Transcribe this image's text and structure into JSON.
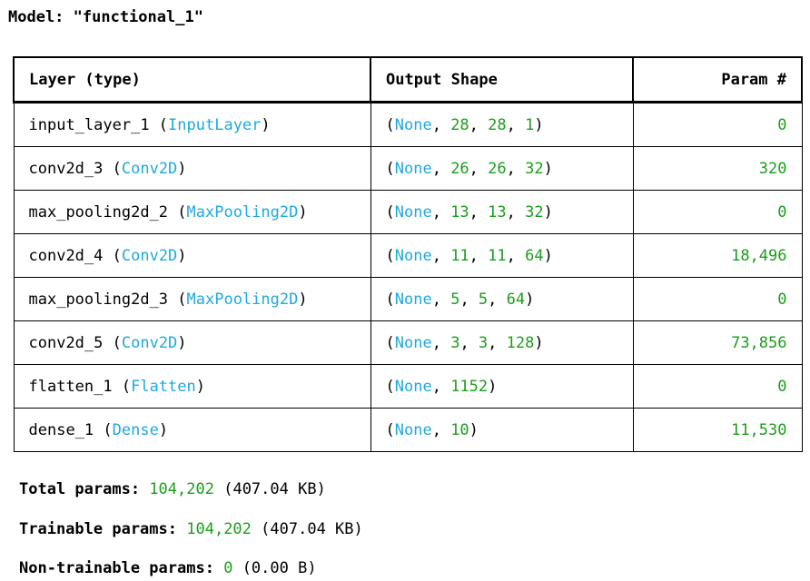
{
  "model": {
    "title": "Model: \"functional_1\""
  },
  "table": {
    "headers": {
      "layer": "Layer (type)",
      "output_shape": "Output Shape",
      "params": "Param #"
    },
    "rows": [
      {
        "name": "input_layer_1",
        "type": "InputLayer",
        "shape_none": "None",
        "shape_rest": [
          "28",
          "28",
          "1"
        ],
        "params": "0"
      },
      {
        "name": "conv2d_3",
        "type": "Conv2D",
        "shape_none": "None",
        "shape_rest": [
          "26",
          "26",
          "32"
        ],
        "params": "320"
      },
      {
        "name": "max_pooling2d_2",
        "type": "MaxPooling2D",
        "shape_none": "None",
        "shape_rest": [
          "13",
          "13",
          "32"
        ],
        "params": "0"
      },
      {
        "name": "conv2d_4",
        "type": "Conv2D",
        "shape_none": "None",
        "shape_rest": [
          "11",
          "11",
          "64"
        ],
        "params": "18,496"
      },
      {
        "name": "max_pooling2d_3",
        "type": "MaxPooling2D",
        "shape_none": "None",
        "shape_rest": [
          "5",
          "5",
          "64"
        ],
        "params": "0"
      },
      {
        "name": "conv2d_5",
        "type": "Conv2D",
        "shape_none": "None",
        "shape_rest": [
          "3",
          "3",
          "128"
        ],
        "params": "73,856"
      },
      {
        "name": "flatten_1",
        "type": "Flatten",
        "shape_none": "None",
        "shape_rest": [
          "1152"
        ],
        "params": "0"
      },
      {
        "name": "dense_1",
        "type": "Dense",
        "shape_none": "None",
        "shape_rest": [
          "10"
        ],
        "params": "11,530"
      }
    ]
  },
  "totals": {
    "total": {
      "label": "Total params:",
      "value": "104,202",
      "size": "(407.04 KB)"
    },
    "trainable": {
      "label": "Trainable params:",
      "value": "104,202",
      "size": "(407.04 KB)"
    },
    "non_trainable": {
      "label": "Non-trainable params:",
      "value": "0",
      "size": "(0.00 B)"
    }
  },
  "colors": {
    "type": "#1fa9de",
    "number": "#1a9e1a",
    "text": "#000000"
  }
}
